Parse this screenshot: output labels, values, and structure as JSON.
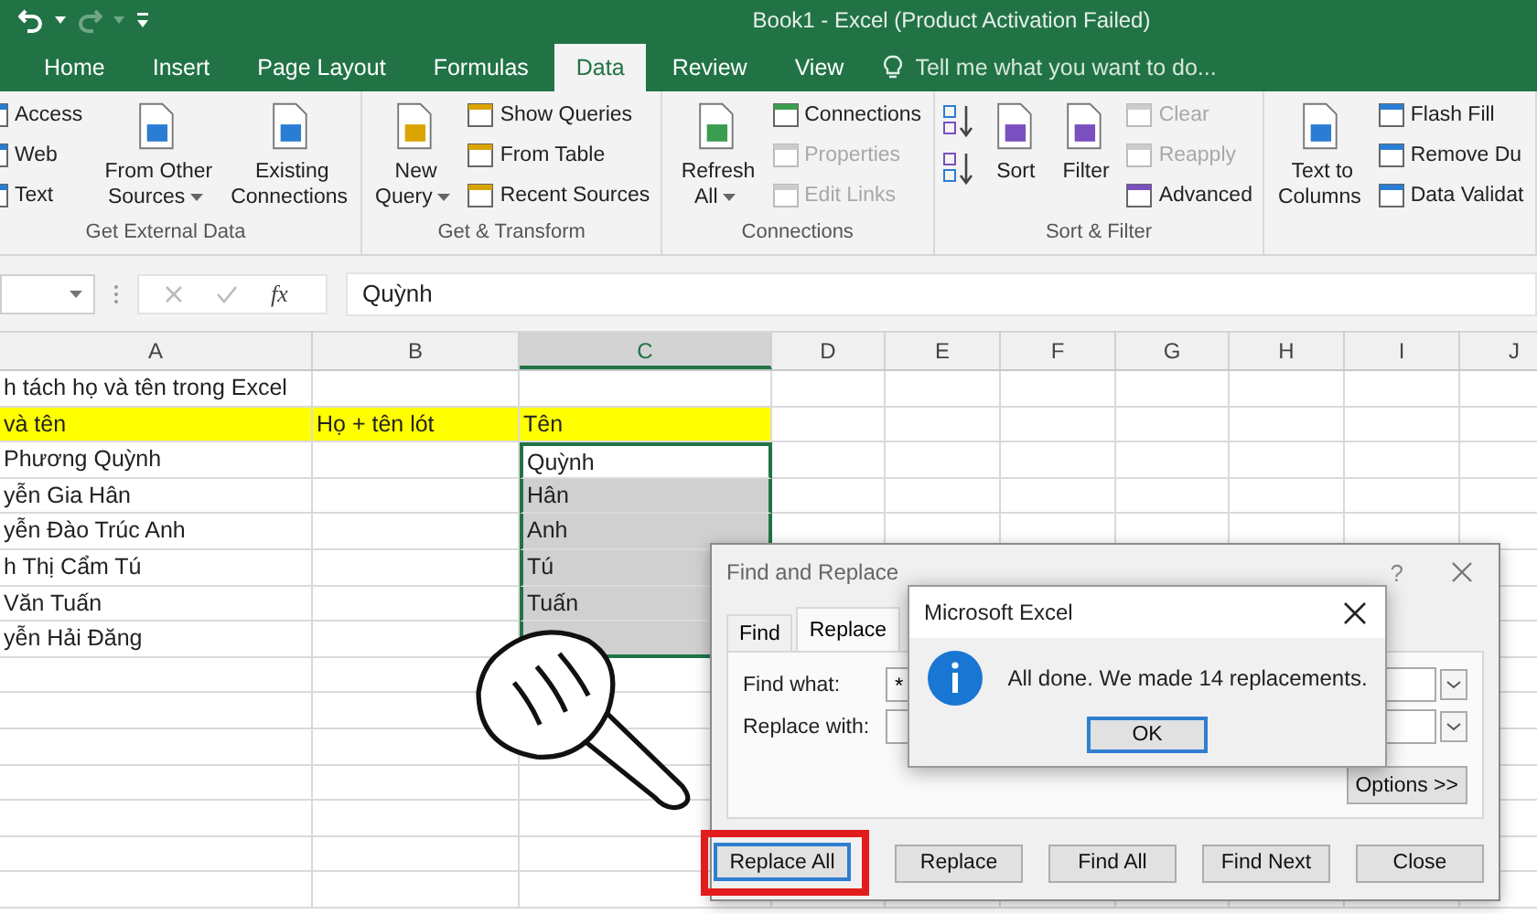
{
  "window": {
    "title": "Book1 - Excel (Product Activation Failed)"
  },
  "tabs": [
    {
      "label": "Home",
      "selected": false
    },
    {
      "label": "Insert",
      "selected": false
    },
    {
      "label": "Page Layout",
      "selected": false
    },
    {
      "label": "Formulas",
      "selected": false
    },
    {
      "label": "Data",
      "selected": true
    },
    {
      "label": "Review",
      "selected": false
    },
    {
      "label": "View",
      "selected": false
    }
  ],
  "tell_me": {
    "placeholder": "Tell me what you want to do..."
  },
  "ribbon": {
    "groups": [
      {
        "label": "Get External Data",
        "columns": [
          {
            "kind": "stack",
            "items": [
              {
                "label": "Access",
                "disabled": false
              },
              {
                "label": "Web",
                "disabled": false
              },
              {
                "label": "Text",
                "disabled": false
              }
            ]
          },
          {
            "kind": "large",
            "label": "From Other\nSources",
            "dropdown": true
          },
          {
            "kind": "large",
            "label": "Existing\nConnections",
            "dropdown": false
          }
        ]
      },
      {
        "label": "Get & Transform",
        "columns": [
          {
            "kind": "large",
            "label": "New\nQuery",
            "dropdown": true
          },
          {
            "kind": "stack",
            "items": [
              {
                "label": "Show Queries",
                "disabled": false
              },
              {
                "label": "From Table",
                "disabled": false
              },
              {
                "label": "Recent Sources",
                "disabled": false
              }
            ]
          }
        ]
      },
      {
        "label": "Connections",
        "columns": [
          {
            "kind": "large",
            "label": "Refresh\nAll",
            "dropdown": true
          },
          {
            "kind": "stack",
            "items": [
              {
                "label": "Connections",
                "disabled": false
              },
              {
                "label": "Properties",
                "disabled": true
              },
              {
                "label": "Edit Links",
                "disabled": true
              }
            ]
          }
        ]
      },
      {
        "label": "Sort & Filter",
        "columns": [
          {
            "kind": "sort_icons"
          },
          {
            "kind": "large",
            "label": "Sort",
            "dropdown": false
          },
          {
            "kind": "large",
            "label": "Filter",
            "dropdown": false
          },
          {
            "kind": "stack",
            "items": [
              {
                "label": "Clear",
                "disabled": true
              },
              {
                "label": "Reapply",
                "disabled": true
              },
              {
                "label": "Advanced",
                "disabled": false
              }
            ]
          }
        ]
      },
      {
        "columns": [
          {
            "kind": "large",
            "label": "Text to\nColumns",
            "dropdown": false
          },
          {
            "kind": "stack",
            "items": [
              {
                "label": "Flash Fill",
                "disabled": false
              },
              {
                "label": "Remove Du",
                "disabled": false
              },
              {
                "label": "Data Validat",
                "disabled": false
              }
            ]
          }
        ]
      }
    ]
  },
  "formula_bar": {
    "function_label": "fx",
    "value": "Quỳnh"
  },
  "sheet": {
    "columns": [
      {
        "label": "A",
        "selected": false
      },
      {
        "label": "B",
        "selected": false
      },
      {
        "label": "C",
        "selected": true
      },
      {
        "label": "D",
        "selected": false
      },
      {
        "label": "E",
        "selected": false
      },
      {
        "label": "F",
        "selected": false
      },
      {
        "label": "G",
        "selected": false
      },
      {
        "label": "H",
        "selected": false
      },
      {
        "label": "I",
        "selected": false
      },
      {
        "label": "J",
        "selected": false
      }
    ],
    "rows": [
      {
        "a": "h tách họ và tên trong Excel",
        "highlight": false,
        "in_selection": false,
        "active": false
      },
      {
        "a": "và tên",
        "b": "Họ + tên lót",
        "c": "Tên",
        "highlight": true,
        "in_selection": false,
        "active": false
      },
      {
        "a": "Phương Quỳnh",
        "c": "Quỳnh",
        "highlight": false,
        "in_selection": true,
        "active": true
      },
      {
        "a": "yễn Gia Hân",
        "c": "Hân",
        "highlight": false,
        "in_selection": true,
        "active": false
      },
      {
        "a": "yễn Đào Trúc Anh",
        "c": "Anh",
        "highlight": false,
        "in_selection": true,
        "active": false
      },
      {
        "a": "h Thị Cẩm Tú",
        "c": "Tú",
        "highlight": false,
        "in_selection": true,
        "active": false
      },
      {
        "a": "Văn Tuấn",
        "c": "Tuấn",
        "highlight": false,
        "in_selection": true,
        "active": false
      },
      {
        "a": "yễn Hải Đăng",
        "highlight": false,
        "in_selection": true,
        "active": false
      }
    ]
  },
  "find_replace": {
    "title": "Find and Replace",
    "help": "?",
    "tabs": [
      {
        "label": "Find",
        "selected": false
      },
      {
        "label": "Replace",
        "selected": true
      }
    ],
    "fields": [
      {
        "label": "Find what:",
        "value": "*"
      },
      {
        "label": "Replace with:"
      }
    ],
    "options_button": "Options >>",
    "buttons": [
      {
        "label": "Replace All",
        "highlighted": true
      },
      {
        "label": "Replace",
        "highlighted": false
      },
      {
        "label": "Find All",
        "highlighted": false
      },
      {
        "label": "Find Next",
        "highlighted": false
      },
      {
        "label": "Close",
        "highlighted": false
      }
    ]
  },
  "message_box": {
    "title": "Microsoft Excel",
    "message": "All done. We made 14 replacements.",
    "button": "OK"
  }
}
